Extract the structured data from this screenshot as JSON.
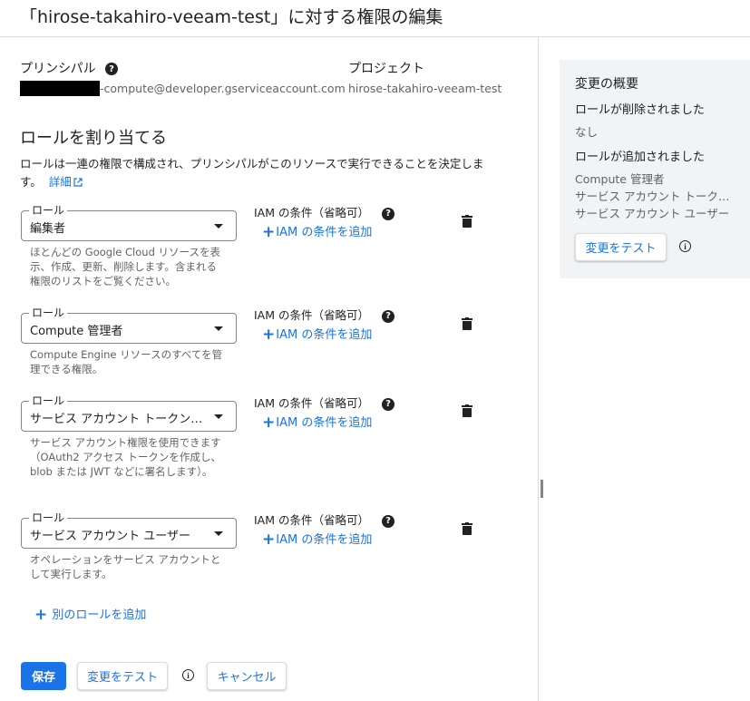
{
  "page_title": "「hirose-takahiro-veeam-test」に対する権限の編集",
  "principal": {
    "label": "プリンシパル",
    "email_visible": "-compute@developer.gserviceaccount.com"
  },
  "project": {
    "label": "プロジェクト",
    "value": "hirose-takahiro-veeam-test"
  },
  "assign": {
    "heading": "ロールを割り当てる",
    "description": "ロールは一連の権限で構成され、プリンシパルがこのリソースで実行できることを決定します。",
    "details_link": "詳細"
  },
  "role_field_label": "ロール",
  "iam_condition_label": "IAM の条件（省略可）",
  "add_condition_label": "IAM の条件を追加",
  "roles": [
    {
      "value": "編集者",
      "description": "ほとんどの Google Cloud リソースを表示、作成、更新、削除します。含まれる権限のリストをご覧ください。"
    },
    {
      "value": "Compute 管理者",
      "description": "Compute Engine リソースのすべてを管理できる権限。"
    },
    {
      "value": "サービス アカウント トークン作成者",
      "description": "サービス アカウント権限を使用できます（OAuth2 アクセス トークンを作成し、blob または JWT などに署名します）。"
    },
    {
      "value": "サービス アカウント ユーザー",
      "description": "オペレーションをサービス アカウントとして実行します。"
    }
  ],
  "add_role_label": "別のロールを追加",
  "buttons": {
    "save": "保存",
    "test_changes": "変更をテスト",
    "cancel": "キャンセル"
  },
  "summary": {
    "title": "変更の概要",
    "removed_heading": "ロールが削除されました",
    "removed_value": "なし",
    "added_heading": "ロールが追加されました",
    "added_items": [
      "Compute 管理者",
      "サービス アカウント トークン作成者",
      "サービス アカウント ユーザー"
    ],
    "test_button": "変更をテスト"
  },
  "colors": {
    "accent": "#1a73e8",
    "panel_bg": "#f1f3f4",
    "divider": "#dadce0"
  }
}
